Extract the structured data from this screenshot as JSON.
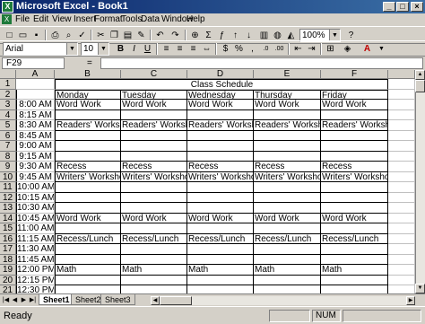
{
  "window": {
    "title": "Microsoft Excel - Book1"
  },
  "menu": [
    "File",
    "Edit",
    "View",
    "Insert",
    "Format",
    "Tools",
    "Data",
    "Window",
    "Help"
  ],
  "toolbar": {
    "zoom": "100%",
    "font_name": "Arial",
    "font_size": "10"
  },
  "formula_bar": {
    "cell_ref": "F29",
    "formula": ""
  },
  "columns": [
    "A",
    "B",
    "C",
    "D",
    "E",
    "F"
  ],
  "rows": [
    {
      "num": "1",
      "cells": [
        "",
        "",
        "",
        "",
        "",
        ""
      ]
    },
    {
      "num": "2",
      "cells": [
        "",
        "Monday",
        "Tuesday",
        "Wednesday",
        "Thursday",
        "Friday"
      ]
    },
    {
      "num": "3",
      "cells": [
        "8:00 AM",
        "Word Work",
        "Word Work",
        "Word Work",
        "Word Work",
        "Word Work"
      ]
    },
    {
      "num": "4",
      "cells": [
        "8:15 AM",
        "",
        "",
        "",
        "",
        ""
      ]
    },
    {
      "num": "5",
      "cells": [
        "8:30 AM",
        "Readers' Workshop",
        "Readers' Workshop",
        "Readers' Workshop",
        "Readers' Workshop",
        "Readers' Worksho"
      ]
    },
    {
      "num": "6",
      "cells": [
        "8:45 AM",
        "",
        "",
        "",
        "",
        ""
      ]
    },
    {
      "num": "7",
      "cells": [
        "9:00 AM",
        "",
        "",
        "",
        "",
        ""
      ]
    },
    {
      "num": "8",
      "cells": [
        "9:15 AM",
        "",
        "",
        "",
        "",
        ""
      ]
    },
    {
      "num": "9",
      "cells": [
        "9:30 AM",
        "Recess",
        "Recess",
        "Recess",
        "Recess",
        "Recess"
      ]
    },
    {
      "num": "10",
      "cells": [
        "9:45 AM",
        "Writers' Workshop",
        "Writers' Workshop",
        "Writers' Workshop",
        "Writers' Workshop",
        "Writers' Worksho"
      ]
    },
    {
      "num": "11",
      "cells": [
        "10:00 AM",
        "",
        "",
        "",
        "",
        ""
      ]
    },
    {
      "num": "12",
      "cells": [
        "10:15 AM",
        "",
        "",
        "",
        "",
        ""
      ]
    },
    {
      "num": "13",
      "cells": [
        "10:30 AM",
        "",
        "",
        "",
        "",
        ""
      ]
    },
    {
      "num": "14",
      "cells": [
        "10:45 AM",
        "Word Work",
        "Word Work",
        "Word Work",
        "Word Work",
        "Word Work"
      ]
    },
    {
      "num": "15",
      "cells": [
        "11:00 AM",
        "",
        "",
        "",
        "",
        ""
      ]
    },
    {
      "num": "16",
      "cells": [
        "11:15 AM",
        "Recess/Lunch",
        "Recess/Lunch",
        "Recess/Lunch",
        "Recess/Lunch",
        "Recess/Lunch"
      ]
    },
    {
      "num": "17",
      "cells": [
        "11:30 AM",
        "",
        "",
        "",
        "",
        ""
      ]
    },
    {
      "num": "18",
      "cells": [
        "11:45 AM",
        "",
        "",
        "",
        "",
        ""
      ]
    },
    {
      "num": "19",
      "cells": [
        "12:00 PM",
        "Math",
        "Math",
        "Math",
        "Math",
        "Math"
      ]
    },
    {
      "num": "20",
      "cells": [
        "12:15 PM",
        "",
        "",
        "",
        "",
        ""
      ]
    },
    {
      "num": "21",
      "cells": [
        "12:30 PM",
        "",
        "",
        "",
        "",
        ""
      ]
    }
  ],
  "sheet_title": "Class Schedule",
  "sheets": [
    "Sheet1",
    "Sheet2",
    "Sheet3"
  ],
  "status": {
    "text": "Ready",
    "mode": "NUM"
  }
}
